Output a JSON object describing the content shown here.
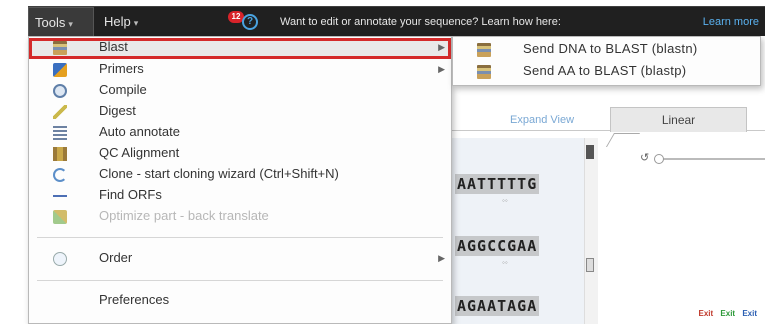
{
  "topbar": {
    "tools_label": "Tools",
    "help_label": "Help",
    "notification_count": "12",
    "help_glyph": "?",
    "promo_text": "Want to edit or annotate your sequence? Learn how here:",
    "learn_more": "Learn more"
  },
  "tools_menu": {
    "items": [
      {
        "label": "Blast",
        "icon": "blast-icon",
        "has_submenu": true,
        "highlighted": true
      },
      {
        "label": "Primers",
        "icon": "primers-icon",
        "has_submenu": true
      },
      {
        "label": "Compile",
        "icon": "compile-icon"
      },
      {
        "label": "Digest",
        "icon": "digest-icon"
      },
      {
        "label": "Auto annotate",
        "icon": "auto-annotate-icon"
      },
      {
        "label": "QC Alignment",
        "icon": "qc-alignment-icon"
      },
      {
        "label": "Clone - start cloning wizard  (Ctrl+Shift+N)",
        "icon": "clone-icon"
      },
      {
        "label": "Find ORFs",
        "icon": "find-orfs-icon"
      },
      {
        "label": "Optimize part - back translate",
        "icon": "optimize-icon",
        "disabled": true
      },
      {
        "label": "Order",
        "icon": "order-icon",
        "has_submenu": true
      },
      {
        "label": "Preferences"
      }
    ]
  },
  "blast_submenu": {
    "items": [
      {
        "label": "Send DNA to BLAST (blastn)",
        "icon": "blast-icon"
      },
      {
        "label": "Send AA to BLAST (blastp)",
        "icon": "blast-icon"
      }
    ]
  },
  "background": {
    "expand_view": "Expand View",
    "linear_tab": "Linear",
    "sequences": [
      "AATTTTTG",
      "AGGCCGAA",
      "AGAATAGA"
    ],
    "footer_links": [
      "Exit",
      "Exit",
      "Exit"
    ]
  },
  "colors": {
    "highlight_border": "#d42a2a",
    "topbar_bg": "#202020",
    "link_blue": "#5ab1ef"
  }
}
